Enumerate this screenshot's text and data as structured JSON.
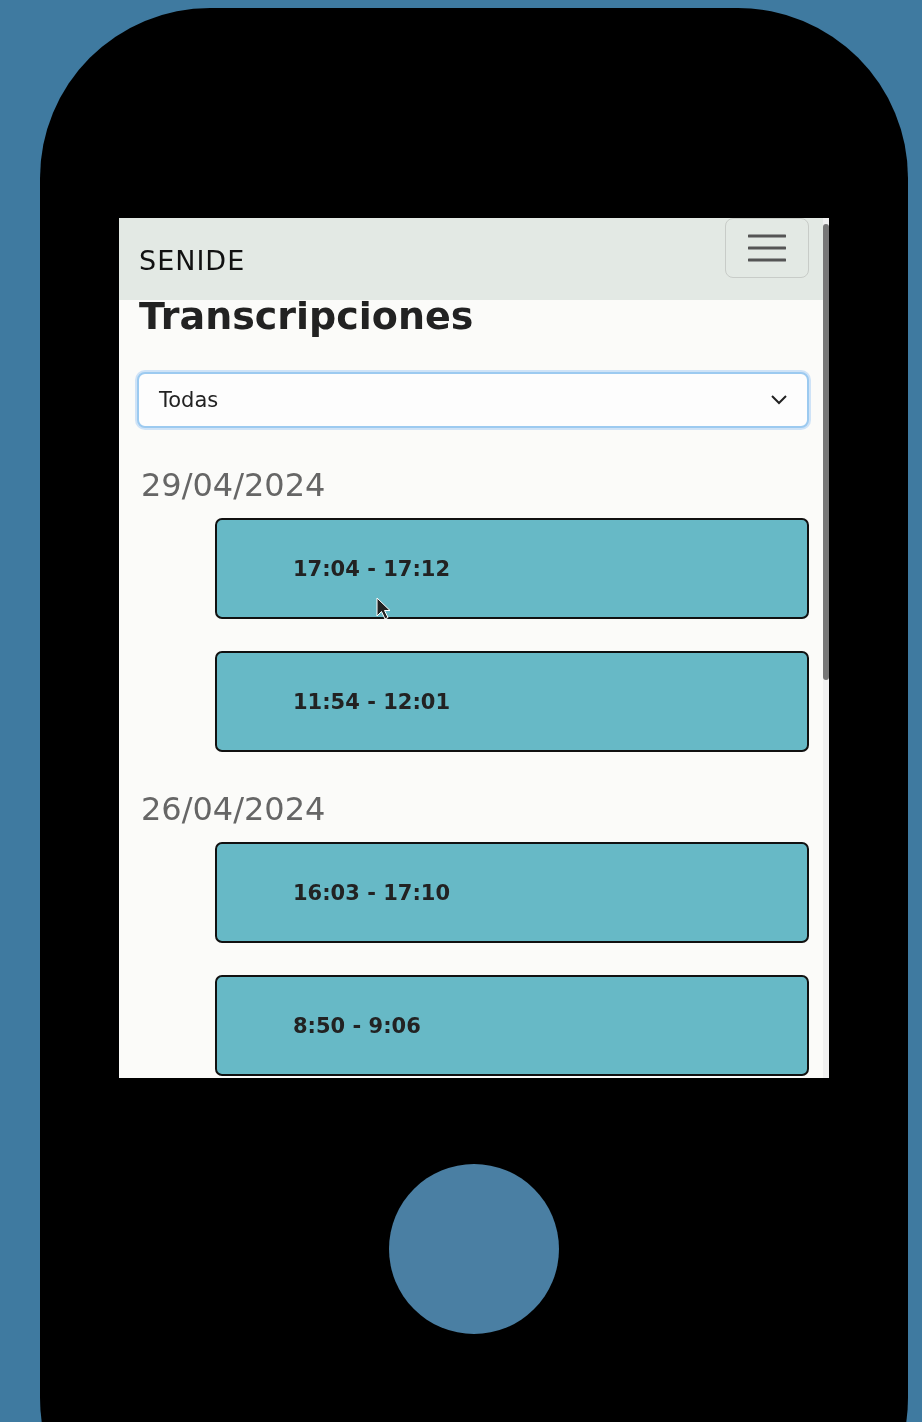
{
  "navbar": {
    "logo": "SENIDE"
  },
  "title": "Transcripciones",
  "filter": {
    "value": "Todas"
  },
  "groups": [
    {
      "date": "29/04/2024",
      "sessions": [
        {
          "time": "17:04 - 17:12"
        },
        {
          "time": "11:54 - 12:01"
        }
      ]
    },
    {
      "date": "26/04/2024",
      "sessions": [
        {
          "time": "16:03 - 17:10"
        },
        {
          "time": "8:50 - 9:06"
        }
      ]
    }
  ]
}
